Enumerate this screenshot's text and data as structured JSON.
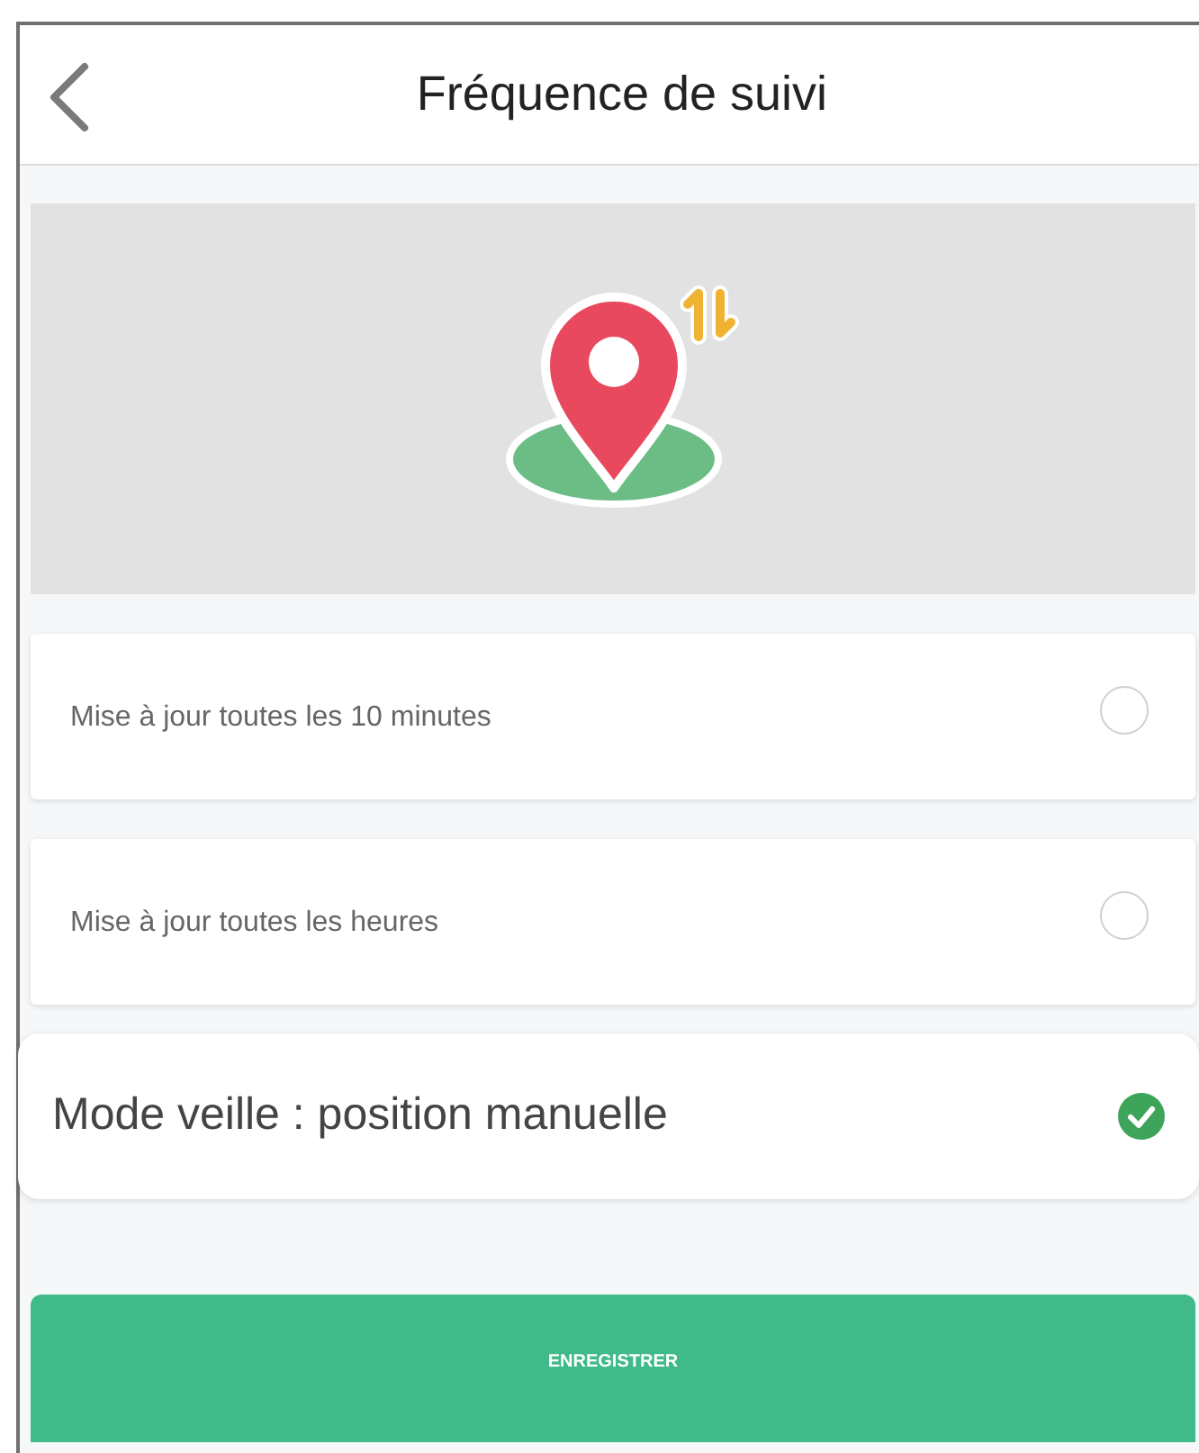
{
  "header": {
    "title": "Fréquence de suivi"
  },
  "options": [
    {
      "label": "Mise à jour toutes les 10 minutes",
      "selected": false
    },
    {
      "label": "Mise à jour toutes les heures",
      "selected": false
    },
    {
      "label": "Mode veille : position manuelle",
      "selected": true
    }
  ],
  "save_button": {
    "label": "ENREGISTRER"
  }
}
